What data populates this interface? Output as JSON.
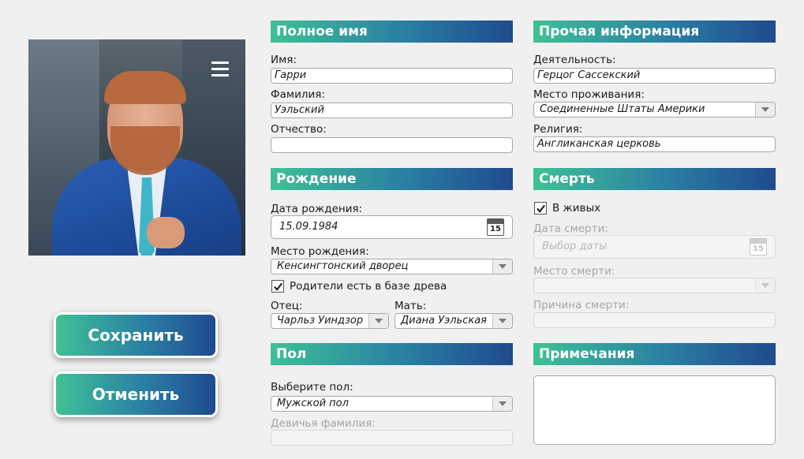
{
  "left": {
    "save_label": "Сохранить",
    "cancel_label": "Отменить"
  },
  "full_name": {
    "title": "Полное имя",
    "first_name_label": "Имя:",
    "first_name_value": "Гарри",
    "last_name_label": "Фамилия:",
    "last_name_value": "Уэльский",
    "patronymic_label": "Отчество:",
    "patronymic_value": ""
  },
  "birth": {
    "title": "Рождение",
    "date_label": "Дата рождения:",
    "date_value": "15.09.1984",
    "place_label": "Место рождения:",
    "place_value": "Кенсингтонский дворец",
    "parents_checkbox_label": "Родители есть в базе древа",
    "father_label": "Отец:",
    "father_value": "Чарльз Уиндзор",
    "mother_label": "Мать:",
    "mother_value": "Диана Уэльская",
    "calendar_day": "15"
  },
  "gender": {
    "title": "Пол",
    "select_label": "Выберите пол:",
    "select_value": "Мужской пол",
    "maiden_name_label": "Девичья фамилия:",
    "maiden_name_value": ""
  },
  "other_info": {
    "title": "Прочая информация",
    "occupation_label": "Деятельность:",
    "occupation_value": "Герцог Сассекский",
    "residence_label": "Место проживания:",
    "residence_value": "Соединенные Штаты Америки",
    "religion_label": "Религия:",
    "religion_value": "Англиканская церковь"
  },
  "death": {
    "title": "Смерть",
    "alive_label": "В живых",
    "date_label": "Дата смерти:",
    "date_placeholder": "Выбор даты",
    "place_label": "Место смерти:",
    "cause_label": "Причина смерти:",
    "calendar_day": "15"
  },
  "notes": {
    "title": "Примечания",
    "value": ""
  }
}
